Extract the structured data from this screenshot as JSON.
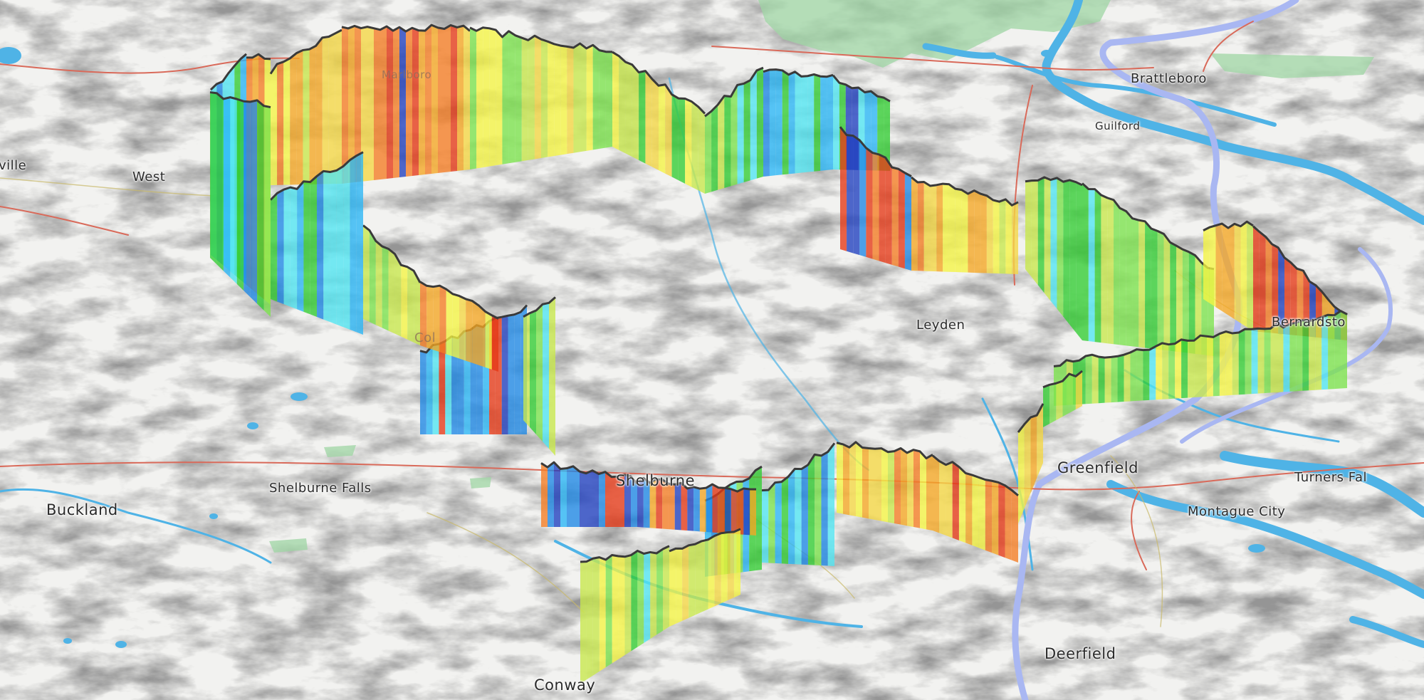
{
  "map": {
    "theme": "3D terrain topographic basemap with extruded boundary wall",
    "colors": {
      "terrain_base": "#eeeeec",
      "water": "#4fb3e6",
      "forest": "#9fd5a4",
      "major_road": "#a9b7f2",
      "minor_road": "#d96a5a",
      "wall_outline": "#3a3a3a"
    },
    "wall_palette": [
      "#1f3fbf",
      "#1e88e5",
      "#29b6f6",
      "#4fe6f2",
      "#32cd32",
      "#7be34b",
      "#c8e84a",
      "#f5f542",
      "#f5d742",
      "#f5a623",
      "#f57c23",
      "#e53916"
    ],
    "labels": {
      "brattleboro": "Brattleboro",
      "guilford": "Guilford",
      "west": "West",
      "ville": "ville",
      "marlboro": "Marlboro",
      "leyden": "Leyden",
      "bernardston": "Bernardsto",
      "greenfield": "Greenfield",
      "turners_falls": "Turners Fal",
      "montague_city": "Montague City",
      "shelburne_falls": "Shelburne Falls",
      "shelburne": "Shelburne",
      "buckland": "Buckland",
      "colrain": "Col",
      "conway": "Conway",
      "deerfield": "Deerfield"
    }
  }
}
